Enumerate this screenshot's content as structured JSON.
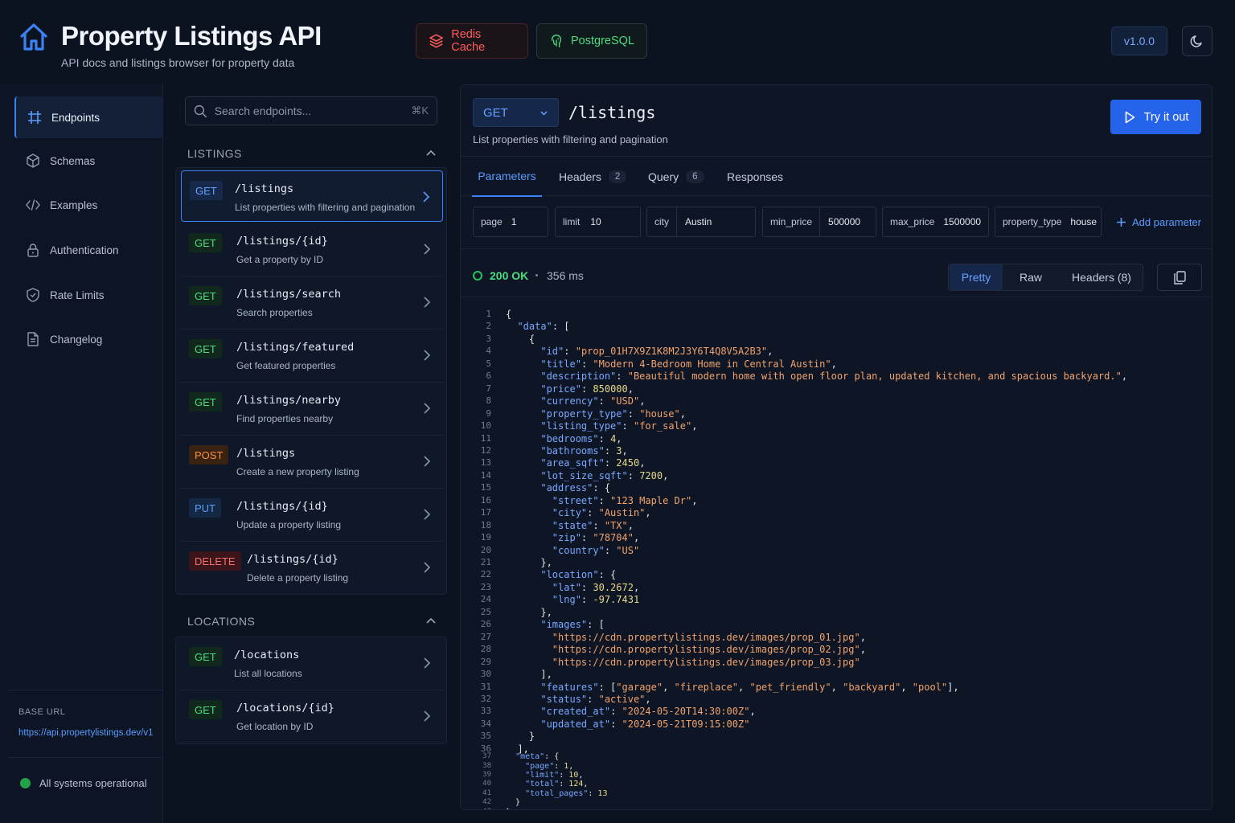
{
  "header": {
    "title": "Property Listings API",
    "subtitle": "API docs and listings browser for property data",
    "badges": [
      {
        "label": "Redis Cache",
        "icon": "layers-icon",
        "color": "#ff5a5a"
      },
      {
        "label": "PostgreSQL",
        "icon": "elephant-icon",
        "color": "#4ade80"
      }
    ],
    "version": "v1.0.0",
    "theme_icon": "moon-icon"
  },
  "nav": {
    "items": [
      {
        "label": "Endpoints",
        "icon": "endpoints-icon",
        "active": true
      },
      {
        "label": "Schemas",
        "icon": "cube-icon"
      },
      {
        "label": "Examples",
        "icon": "code-icon"
      },
      {
        "label": "Authentication",
        "icon": "lock-icon"
      },
      {
        "label": "Rate Limits",
        "icon": "shield-icon"
      },
      {
        "label": "Changelog",
        "icon": "document-icon"
      }
    ],
    "base_url_label": "BASE URL",
    "base_url": "https://api.propertylistings.dev/v1",
    "status": "All systems operational"
  },
  "list": {
    "search_placeholder": "Search endpoints...",
    "shortcut": "⌘K",
    "sections": [
      {
        "title": "LISTINGS",
        "endpoints": [
          {
            "method": "GET",
            "path": "/listings",
            "desc": "List properties with filtering and pagination",
            "selected": true
          },
          {
            "method": "GET",
            "path": "/listings/{id}",
            "desc": "Get a property by ID"
          },
          {
            "method": "GET",
            "path": "/listings/search",
            "desc": "Search properties"
          },
          {
            "method": "GET",
            "path": "/listings/featured",
            "desc": "Get featured properties"
          },
          {
            "method": "GET",
            "path": "/listings/nearby",
            "desc": "Find properties nearby"
          },
          {
            "method": "POST",
            "path": "/listings",
            "desc": "Create a new property listing"
          },
          {
            "method": "PUT",
            "path": "/listings/{id}",
            "desc": "Update a property listing"
          },
          {
            "method": "DELETE",
            "path": "/listings/{id}",
            "desc": "Delete a property listing"
          }
        ]
      },
      {
        "title": "LOCATIONS",
        "endpoints": [
          {
            "method": "GET",
            "path": "/locations",
            "desc": "List all locations"
          },
          {
            "method": "GET",
            "path": "/locations/{id}",
            "desc": "Get location by ID"
          }
        ]
      }
    ]
  },
  "detail": {
    "method": "GET",
    "path": "/listings",
    "description": "List properties with filtering and pagination",
    "try_label": "Try it out",
    "tabs": [
      {
        "label": "Parameters",
        "count": "",
        "active": true
      },
      {
        "label": "Headers",
        "count": "2"
      },
      {
        "label": "Query",
        "count": "6"
      },
      {
        "label": "Responses",
        "count": ""
      }
    ],
    "params": [
      {
        "key": "page",
        "value": "1"
      },
      {
        "key": "limit",
        "value": "10"
      },
      {
        "key": "city",
        "value": "Austin"
      },
      {
        "key": "min_price",
        "value": "500000"
      },
      {
        "key": "max_price",
        "value": "1500000"
      },
      {
        "key": "property_type",
        "value": "house"
      }
    ],
    "add_param_label": "Add parameter",
    "response": {
      "status": "200 OK",
      "time": "356 ms",
      "views": [
        "Pretty",
        "Raw",
        "Headers (8)"
      ],
      "active_view": "Pretty"
    },
    "code_lines": [
      "{",
      "  \"data\": [",
      "    {",
      "      \"id\": \"prop_01H7X9Z1K8M2J3Y6T4Q8V5A2B3\",",
      "      \"title\": \"Modern 4-Bedroom Home in Central Austin\",",
      "      \"description\": \"Beautiful modern home with open floor plan, updated kitchen, and spacious backyard.\",",
      "      \"price\": 850000,",
      "      \"currency\": \"USD\",",
      "      \"property_type\": \"house\",",
      "      \"listing_type\": \"for_sale\",",
      "      \"bedrooms\": 4,",
      "      \"bathrooms\": 3,",
      "      \"area_sqft\": 2450,",
      "      \"lot_size_sqft\": 7200,",
      "      \"address\": {",
      "        \"street\": \"123 Maple Dr\",",
      "        \"city\": \"Austin\",",
      "        \"state\": \"TX\",",
      "        \"zip\": \"78704\",",
      "        \"country\": \"US\"",
      "      },",
      "      \"location\": {",
      "        \"lat\": 30.2672,",
      "        \"lng\": -97.7431",
      "      },",
      "      \"images\": [",
      "        \"https://cdn.propertylistings.dev/images/prop_01.jpg\",",
      "        \"https://cdn.propertylistings.dev/images/prop_02.jpg\",",
      "        \"https://cdn.propertylistings.dev/images/prop_03.jpg\"",
      "      ],",
      "      \"features\": [\"garage\", \"fireplace\", \"pet_friendly\", \"backyard\", \"pool\"],",
      "      \"status\": \"active\",",
      "      \"created_at\": \"2024-05-20T14:30:00Z\",",
      "      \"updated_at\": \"2024-05-21T09:15:00Z\"",
      "    }",
      "  ],",
      "  \"meta\": {",
      "    \"page\": 1,",
      "    \"limit\": 10,",
      "    \"total\": 124,",
      "    \"total_pages\": 13",
      "  }",
      "}"
    ]
  }
}
